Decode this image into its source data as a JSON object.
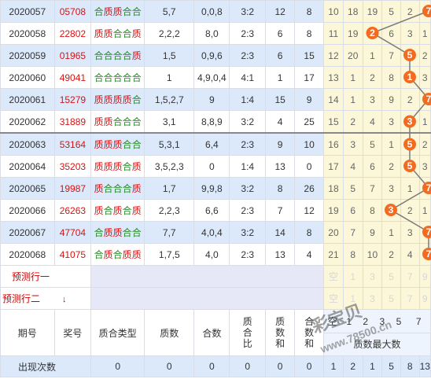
{
  "rows": [
    {
      "period": "2020057",
      "prize": "05708",
      "type": "合质质合合",
      "prime": "5,7",
      "comp": "0,0,8",
      "ratio": "3:2",
      "psum": "12",
      "csum": "8",
      "balls": [
        "10",
        "18",
        "19",
        "5",
        "2",
        "7"
      ],
      "hit": "7"
    },
    {
      "period": "2020058",
      "prize": "22802",
      "type": "质质合合质",
      "prime": "2,2,2",
      "comp": "8,0",
      "ratio": "2:3",
      "psum": "6",
      "csum": "8",
      "balls": [
        "11",
        "19",
        "2",
        "6",
        "3",
        "1"
      ],
      "hit": "2"
    },
    {
      "period": "2020059",
      "prize": "01965",
      "type": "合合合合质",
      "prime": "1,5",
      "comp": "0,9,6",
      "ratio": "2:3",
      "psum": "6",
      "csum": "15",
      "balls": [
        "12",
        "20",
        "1",
        "7",
        "5",
        "2"
      ],
      "hit": "5"
    },
    {
      "period": "2020060",
      "prize": "49041",
      "type": "合合合合合",
      "prime": "1",
      "comp": "4,9,0,4",
      "ratio": "4:1",
      "psum": "1",
      "csum": "17",
      "balls": [
        "13",
        "1",
        "2",
        "8",
        "1",
        "3"
      ],
      "hit": "1"
    },
    {
      "period": "2020061",
      "prize": "15279",
      "type": "质质质质合",
      "prime": "1,5,2,7",
      "comp": "9",
      "ratio": "1:4",
      "psum": "15",
      "csum": "9",
      "balls": [
        "14",
        "1",
        "3",
        "9",
        "2",
        "7"
      ],
      "hit": "7"
    },
    {
      "period": "2020062",
      "prize": "31889",
      "type": "质质合合合",
      "prime": "3,1",
      "comp": "8,8,9",
      "ratio": "3:2",
      "psum": "4",
      "csum": "25",
      "balls": [
        "15",
        "2",
        "4",
        "3",
        "3",
        "1"
      ],
      "hit": "3"
    },
    {
      "period": "2020063",
      "prize": "53164",
      "type": "质质质合合",
      "prime": "5,3,1",
      "comp": "6,4",
      "ratio": "2:3",
      "psum": "9",
      "csum": "10",
      "balls": [
        "16",
        "3",
        "5",
        "1",
        "5",
        "2"
      ],
      "hit": "5"
    },
    {
      "period": "2020064",
      "prize": "35203",
      "type": "质质质合质",
      "prime": "3,5,2,3",
      "comp": "0",
      "ratio": "1:4",
      "psum": "13",
      "csum": "0",
      "balls": [
        "17",
        "4",
        "6",
        "2",
        "5",
        "3"
      ],
      "hit": "5"
    },
    {
      "period": "2020065",
      "prize": "19987",
      "type": "质合合合质",
      "prime": "1,7",
      "comp": "9,9,8",
      "ratio": "3:2",
      "psum": "8",
      "csum": "26",
      "balls": [
        "18",
        "5",
        "7",
        "3",
        "1",
        "7"
      ],
      "hit": "7"
    },
    {
      "period": "2020066",
      "prize": "26263",
      "type": "质合质合质",
      "prime": "2,2,3",
      "comp": "6,6",
      "ratio": "2:3",
      "psum": "7",
      "csum": "12",
      "balls": [
        "19",
        "6",
        "8",
        "3",
        "2",
        "1"
      ],
      "hit": "3"
    },
    {
      "period": "2020067",
      "prize": "47704",
      "type": "合质质合合",
      "prime": "7,7",
      "comp": "4,0,4",
      "ratio": "3:2",
      "psum": "14",
      "csum": "8",
      "balls": [
        "20",
        "7",
        "9",
        "1",
        "3",
        "7"
      ],
      "hit": "7"
    },
    {
      "period": "2020068",
      "prize": "41075",
      "type": "合质合质质",
      "prime": "1,7,5",
      "comp": "4,0",
      "ratio": "2:3",
      "psum": "13",
      "csum": "4",
      "balls": [
        "21",
        "8",
        "10",
        "2",
        "4",
        "7"
      ],
      "hit": "7"
    }
  ],
  "predict1": {
    "label": "预测行一",
    "balls": [
      "空",
      "1",
      "3",
      "5",
      "7",
      "9"
    ]
  },
  "predict2": {
    "label": "预测行二",
    "arrow": "↓",
    "balls": [
      "空",
      "1",
      "3",
      "5",
      "7",
      "9"
    ]
  },
  "header": {
    "period": "期号",
    "prize": "奖号",
    "type": "质合类型",
    "prime": "质数",
    "comp": "合数",
    "ratio": "质合比",
    "psum": "质数和",
    "csum": "合数和",
    "balls": [
      "空",
      "1",
      "2",
      "3",
      "5",
      "7"
    ],
    "ballsTitle": "质数最大数"
  },
  "footer": {
    "label": "出现次数",
    "type": "0",
    "prime": "0",
    "comp": "0",
    "ratio": "0",
    "psum": "0",
    "csum": "0",
    "balls": [
      "1",
      "2",
      "1",
      "5",
      "8",
      "13"
    ]
  },
  "watermark": {
    "brand": "彩宝贝",
    "url": "www.78500.cn"
  },
  "colors": {
    "hit": "#f26b21",
    "line": "#7a7a7a",
    "prime": "#d11111",
    "composite": "#2a8a2a"
  }
}
